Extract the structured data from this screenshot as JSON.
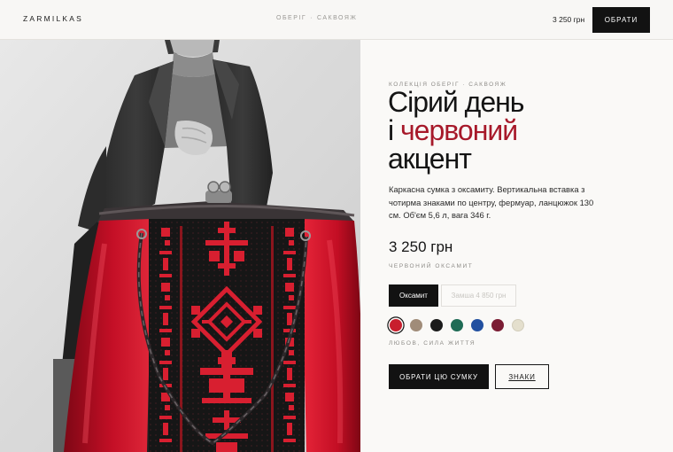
{
  "header": {
    "brand": "ZARMILKAS",
    "breadcrumb": [
      "ОБЕРІГ",
      "САКВОЯЖ"
    ],
    "breadcrumb_separator": "·",
    "price": "3 250 грн",
    "cta_label": "ОБРАТИ"
  },
  "hero": {
    "image_subject": "woman-holding-red-velvet-frame-bag",
    "colors": {
      "velvet": "#c8102e",
      "panel": "#141414",
      "embroidery": "#d81f30",
      "chain": "#2a2628"
    }
  },
  "product": {
    "eyebrow": "КОЛЕКЦІЯ ОБЕРІГ · САКВОЯЖ",
    "title_line1": "Сірий день",
    "title_line2_prefix": "і ",
    "title_line2_accent": "червоний",
    "title_line3": "акцент",
    "accent_color": "#a7192a",
    "description": "Каркасна сумка з оксамиту. Вертикальна вставка з чотирма знаками по центру, фермуар, ланцюжок 130 см. Об'єм 5,6 л, вага 346 г.",
    "price": "3 250 грн",
    "material_label": "ЧЕРВОНИЙ ОКСАМИТ",
    "materials": [
      {
        "label": "Оксамит",
        "selected": true
      },
      {
        "label": "Замша 4 850 грн",
        "selected": false
      }
    ],
    "swatches": [
      {
        "name": "red",
        "color": "#c81e2d",
        "selected": true
      },
      {
        "name": "taupe",
        "color": "#a08c79",
        "selected": false
      },
      {
        "name": "black",
        "color": "#1b1b1b",
        "selected": false
      },
      {
        "name": "green",
        "color": "#1f6b55",
        "selected": false
      },
      {
        "name": "blue",
        "color": "#2250a0",
        "selected": false
      },
      {
        "name": "wine",
        "color": "#7b1d34",
        "selected": false
      },
      {
        "name": "cream",
        "color": "#e4dfcd",
        "selected": false
      }
    ],
    "meaning": "ЛЮБОВ, СИЛА ЖИТТЯ",
    "buy_label": "ОБРАТИ ЦЮ СУМКУ",
    "signs_label": "ЗНАКИ"
  }
}
